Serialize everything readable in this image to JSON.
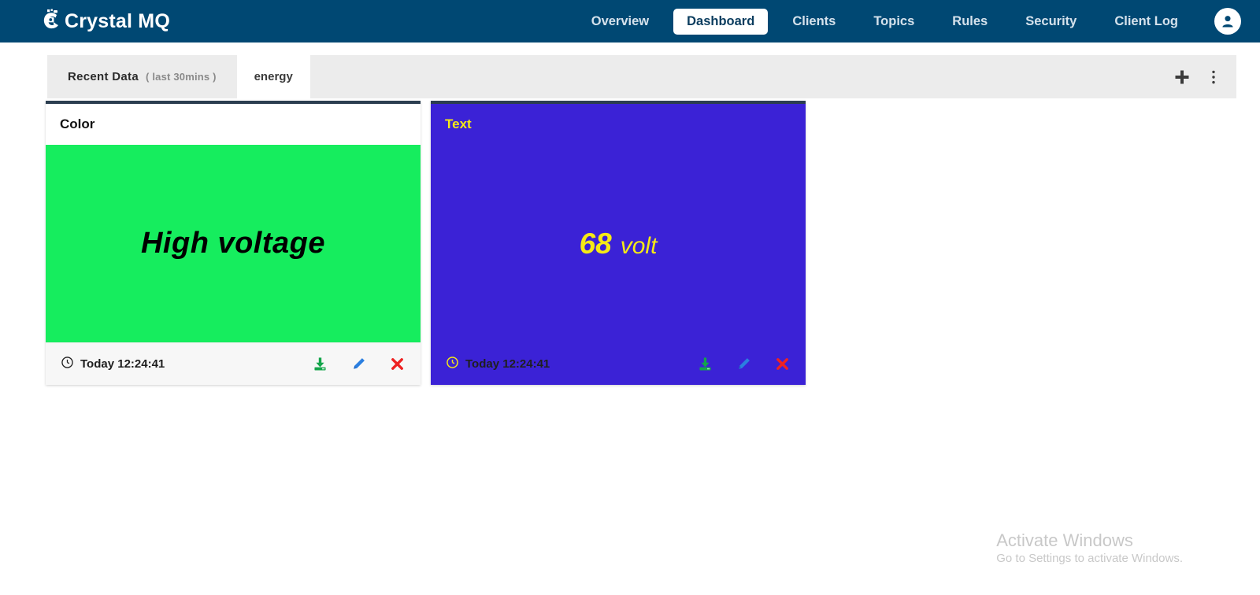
{
  "brand": {
    "name": "Crystal MQ",
    "logo_icon": "crystal-mq-logo-icon"
  },
  "nav": {
    "items": [
      {
        "label": "Overview",
        "active": false
      },
      {
        "label": "Dashboard",
        "active": true
      },
      {
        "label": "Clients",
        "active": false
      },
      {
        "label": "Topics",
        "active": false
      },
      {
        "label": "Rules",
        "active": false
      },
      {
        "label": "Security",
        "active": false
      },
      {
        "label": "Client Log",
        "active": false
      }
    ],
    "avatar_icon": "user-avatar-icon"
  },
  "tabbar": {
    "title": "Recent Data",
    "subtitle": "( last 30mins )",
    "tabs": [
      {
        "label": "energy",
        "active": true
      }
    ],
    "add_icon": "plus-icon",
    "more_icon": "kebab-menu-icon"
  },
  "cards": [
    {
      "id": "card-color",
      "title": "Color",
      "body_text": "High voltage",
      "body_bg": "#16ed5e",
      "body_text_color": "#000000",
      "header_bg": "#ffffff",
      "header_color": "#111111",
      "footer_bg": "#f7f7f7",
      "timestamp": "Today 12:24:41",
      "clock_icon": "clock-icon",
      "clock_color": "#1f1f1f",
      "actions": [
        {
          "name": "download-icon",
          "label": "Download",
          "color": "#13a54a"
        },
        {
          "name": "edit-pencil-icon",
          "label": "Edit",
          "color": "#2b7fe0"
        },
        {
          "name": "delete-x-icon",
          "label": "Delete",
          "color": "#ee2222"
        }
      ]
    },
    {
      "id": "card-text",
      "title": "Text",
      "value": "68",
      "unit": "volt",
      "body_bg": "#3b22d6",
      "title_color": "#f5e916",
      "value_color": "#f5e916",
      "timestamp": "Today 12:24:41",
      "clock_icon": "clock-icon",
      "clock_color": "#f5e916",
      "actions": [
        {
          "name": "download-icon",
          "label": "Download",
          "color": "#13a54a"
        },
        {
          "name": "edit-pencil-icon",
          "label": "Edit",
          "color": "#2b7fe0"
        },
        {
          "name": "delete-x-icon",
          "label": "Delete",
          "color": "#ee2222"
        }
      ]
    }
  ],
  "watermark": {
    "title": "Activate Windows",
    "subtitle": "Go to Settings to activate Windows."
  },
  "colors": {
    "navbar": "#004873",
    "tabbar": "#ececec",
    "accent_green": "#16ed5e",
    "accent_purple": "#3b22d6",
    "accent_yellow": "#f5e916",
    "card_border_top": "#2c3e50"
  }
}
